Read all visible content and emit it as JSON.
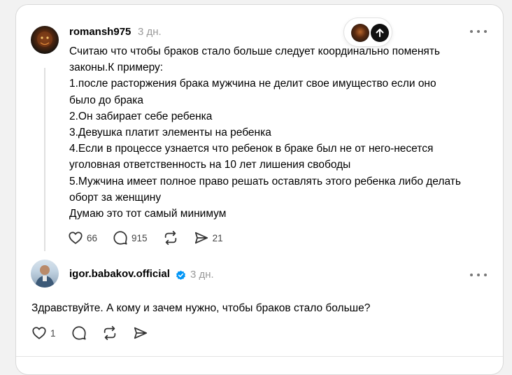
{
  "post": {
    "username": "romansh975",
    "time": "3 дн.",
    "text": "Считаю что чтобы браков стало больше следует координально поменять\nзаконы.К примеру:\n1.после расторжения брака мужчина не делит свое имущество если оно\nбыло до брака\n2.Он забирает себе ребенка\n3.Девушка платит элементы на ребенка\n4.Если в процессе узнается что ребенок в браке был не от него-несется\nуголовная ответственность на 10 лет лишения свободы\n5.Мужчина имеет полное право решать оставлять этого ребенка либо делать\nоборт за женщину\nДумаю это тот самый минимум",
    "likes": "66",
    "comments": "915",
    "shares": "21",
    "avatar_icon": "user-avatar-lion"
  },
  "reply": {
    "username": "igor.babakov.official",
    "verified": true,
    "time": "3 дн.",
    "text": "Здравствуйте. А кому и зачем нужно, чтобы браков стало больше?",
    "likes": "1",
    "avatar_icon": "user-avatar-photo"
  },
  "colors": {
    "verified_badge": "#0095f6",
    "timestamp": "#999999",
    "icon": "#333333"
  }
}
